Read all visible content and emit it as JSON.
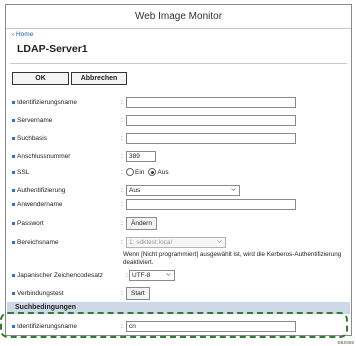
{
  "app_title": "Web Image Monitor",
  "home_link": "‹ Home",
  "page_title": "LDAP-Server1",
  "buttons": {
    "ok": "OK",
    "cancel": "Abbrechen"
  },
  "form": {
    "identifizierungsname": {
      "label": "Identifizierungsname",
      "value": ""
    },
    "servername": {
      "label": "Servername",
      "value": ""
    },
    "suchbasis": {
      "label": "Suchbasis",
      "value": ""
    },
    "anschlussnummer": {
      "label": "Anschlussnummer",
      "value": "389"
    },
    "ssl": {
      "label": "SSL",
      "option_on": "Ein",
      "option_off": "Aus",
      "selected": "Aus"
    },
    "authentifizierung": {
      "label": "Authentifizierung",
      "value": "Aus"
    },
    "anwendername": {
      "label": "Anwendername",
      "value": ""
    },
    "passwort": {
      "label": "Passwort",
      "button": "Ändern"
    },
    "bereichsname": {
      "label": "Bereichsname",
      "value": "1: sdktest.local",
      "note": "Wenn [Nicht programmiert] ausgewählt ist, wird die Kerberos-Authentifizierung deaktiviert."
    },
    "zeichencodesatz": {
      "label": "Japanischer Zeichencodesatz",
      "value": "UTF-8"
    },
    "verbindungstest": {
      "label": "Verbindungstest",
      "button": "Start"
    }
  },
  "search_section": {
    "title": "Suchbedingungen",
    "identifizierungsname": {
      "label": "Identifizierungsname",
      "value": "cn"
    }
  },
  "figure_code": "EBS065",
  "colors": {
    "accent": "#3b6fb8",
    "highlight": "#2e7d32",
    "section_bg": "#cfd8e6"
  },
  "colon": ":"
}
